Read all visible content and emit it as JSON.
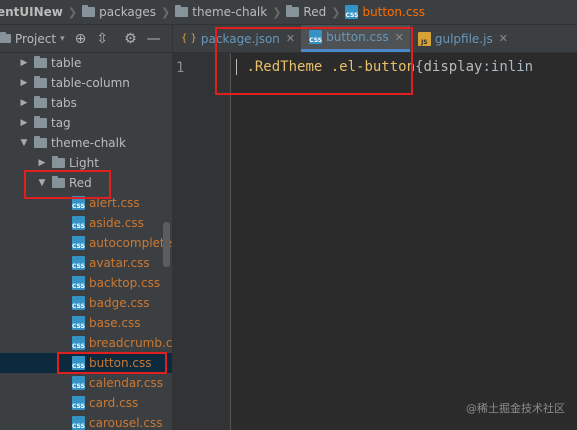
{
  "breadcrumb": [
    "entUINew",
    "packages",
    "theme-chalk",
    "Red",
    "button.css"
  ],
  "project_panel": {
    "title": "Project",
    "tools": [
      "target-icon",
      "collapse-icon",
      "settings-icon",
      "minimize-icon"
    ]
  },
  "tree": [
    {
      "label": "table",
      "depth": 1,
      "type": "folder",
      "expanded": false
    },
    {
      "label": "table-column",
      "depth": 1,
      "type": "folder",
      "expanded": false
    },
    {
      "label": "tabs",
      "depth": 1,
      "type": "folder",
      "expanded": false
    },
    {
      "label": "tag",
      "depth": 1,
      "type": "folder",
      "expanded": false
    },
    {
      "label": "theme-chalk",
      "depth": 1,
      "type": "folder",
      "expanded": true
    },
    {
      "label": "Light",
      "depth": 2,
      "type": "folder",
      "expanded": false
    },
    {
      "label": "Red",
      "depth": 2,
      "type": "folder",
      "expanded": true
    },
    {
      "label": "alert.css",
      "depth": 3,
      "type": "css"
    },
    {
      "label": "aside.css",
      "depth": 3,
      "type": "css"
    },
    {
      "label": "autocomplete",
      "depth": 3,
      "type": "css"
    },
    {
      "label": "avatar.css",
      "depth": 3,
      "type": "css"
    },
    {
      "label": "backtop.css",
      "depth": 3,
      "type": "css"
    },
    {
      "label": "badge.css",
      "depth": 3,
      "type": "css"
    },
    {
      "label": "base.css",
      "depth": 3,
      "type": "css"
    },
    {
      "label": "breadcrumb.c",
      "depth": 3,
      "type": "css"
    },
    {
      "label": "button.css",
      "depth": 3,
      "type": "css",
      "selected": true
    },
    {
      "label": "calendar.css",
      "depth": 3,
      "type": "css"
    },
    {
      "label": "card.css",
      "depth": 3,
      "type": "css"
    },
    {
      "label": "carousel.css",
      "depth": 3,
      "type": "css"
    }
  ],
  "tabs": [
    {
      "label": "package.json",
      "icon": "json-icon",
      "active": false
    },
    {
      "label": "button.css",
      "icon": "css",
      "active": true
    },
    {
      "label": "gulpfile.js",
      "icon": "js",
      "active": false
    }
  ],
  "editor": {
    "line_number": "1",
    "tokens": [
      {
        "text": ".RedTheme",
        "kind": "selector"
      },
      {
        "text": " ",
        "kind": "plain"
      },
      {
        "text": ".el-button",
        "kind": "selector"
      },
      {
        "text": "{",
        "kind": "plain"
      },
      {
        "text": "display",
        "kind": "property"
      },
      {
        "text": ":inlin",
        "kind": "plain"
      }
    ]
  },
  "watermark": "@稀土掘金技术社区",
  "colors": {
    "highlight": "#e02020",
    "accent": "#4a88c7",
    "css_file": "#cc7832"
  }
}
